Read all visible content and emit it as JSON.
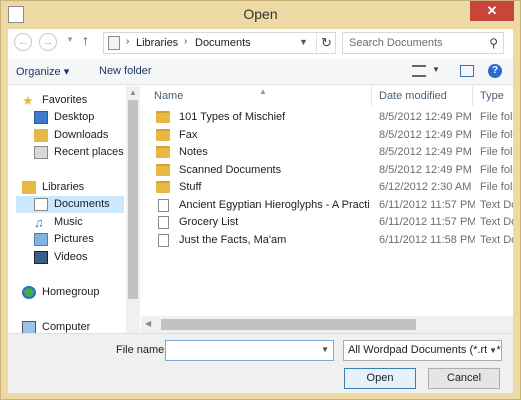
{
  "window": {
    "title": "Open",
    "close_glyph": "✕"
  },
  "address": {
    "back_glyph": "←",
    "forward_glyph": "→",
    "up_glyph": "↑",
    "segments": [
      "Libraries",
      "Documents"
    ],
    "separator": "›",
    "refresh_glyph": "↻"
  },
  "search": {
    "placeholder": "Search Documents"
  },
  "toolbar": {
    "organize_label": "Organize ▾",
    "new_folder_label": "New folder",
    "help_glyph": "?"
  },
  "nav": {
    "items": [
      {
        "label": "Favorites",
        "icon": "star-icon"
      },
      {
        "label": "Desktop",
        "icon": "desktop-icon"
      },
      {
        "label": "Downloads",
        "icon": "downloads-icon"
      },
      {
        "label": "Recent places",
        "icon": "recent-places-icon"
      },
      {
        "label": "Libraries",
        "icon": "libraries-icon"
      },
      {
        "label": "Documents",
        "icon": "documents-icon",
        "selected": true
      },
      {
        "label": "Music",
        "icon": "music-icon"
      },
      {
        "label": "Pictures",
        "icon": "pictures-icon"
      },
      {
        "label": "Videos",
        "icon": "videos-icon"
      },
      {
        "label": "Homegroup",
        "icon": "homegroup-icon"
      },
      {
        "label": "Computer",
        "icon": "computer-icon"
      }
    ]
  },
  "columns": {
    "name": "Name",
    "date": "Date modified",
    "type": "Type"
  },
  "files": [
    {
      "name": "101 Types of Mischief",
      "date": "8/5/2012 12:49 PM",
      "type": "File folder",
      "kind": "folder"
    },
    {
      "name": "Fax",
      "date": "8/5/2012 12:49 PM",
      "type": "File folder",
      "kind": "folder"
    },
    {
      "name": "Notes",
      "date": "8/5/2012 12:49 PM",
      "type": "File folder",
      "kind": "folder"
    },
    {
      "name": "Scanned Documents",
      "date": "8/5/2012 12:49 PM",
      "type": "File folder",
      "kind": "folder"
    },
    {
      "name": "Stuff",
      "date": "6/12/2012 2:30 AM",
      "type": "File folder",
      "kind": "folder"
    },
    {
      "name": "Ancient Egyptian Hieroglyphs - A Practic...",
      "date": "6/11/2012 11:57 PM",
      "type": "Text Docu",
      "kind": "document"
    },
    {
      "name": "Grocery List",
      "date": "6/11/2012 11:57 PM",
      "type": "Text Docu",
      "kind": "document"
    },
    {
      "name": "Just the Facts, Ma'am",
      "date": "6/11/2012 11:58 PM",
      "type": "Text Docu",
      "kind": "document"
    }
  ],
  "bottom": {
    "file_name_label": "File name:",
    "file_name_value": "",
    "filter_value": "All Wordpad Documents (*.rtf, *",
    "open_label": "Open",
    "cancel_label": "Cancel"
  },
  "colors": {
    "frame": "#ecd9a3",
    "close": "#c7453b",
    "selection": "#cce8ff",
    "folder": "#e8b847"
  }
}
